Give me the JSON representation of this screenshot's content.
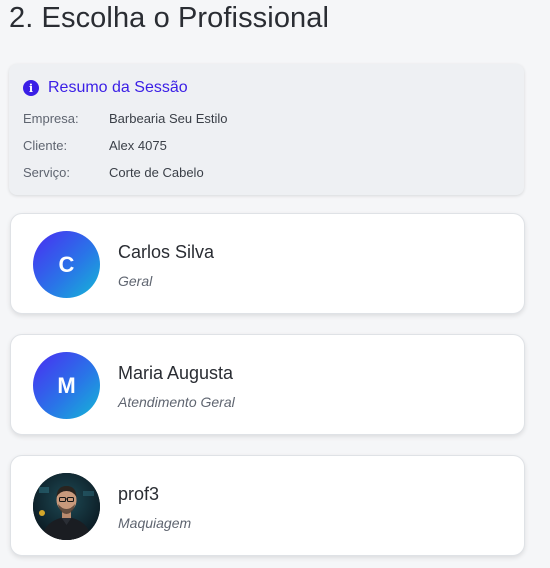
{
  "page": {
    "title": "2. Escolha o Profissional"
  },
  "summary": {
    "title": "Resumo da Sessão",
    "icon": "info-icon",
    "rows": [
      {
        "key": "Empresa:",
        "value": "Barbearia Seu Estilo"
      },
      {
        "key": "Cliente:",
        "value": "Alex 4075"
      },
      {
        "key": "Serviço:",
        "value": "Corte de Cabelo"
      }
    ]
  },
  "professionals": [
    {
      "initial": "C",
      "name": "Carlos Silva",
      "role": "Geral"
    },
    {
      "initial": "M",
      "name": "Maria Augusta",
      "role": "Atendimento Geral"
    },
    {
      "initial": "",
      "name": "prof3",
      "role": "Maquiagem",
      "avatar": "photo"
    }
  ],
  "colors": {
    "accent": "#3a1ee6",
    "gradient_start": "#4a2cf2",
    "gradient_end": "#14b8d6"
  }
}
